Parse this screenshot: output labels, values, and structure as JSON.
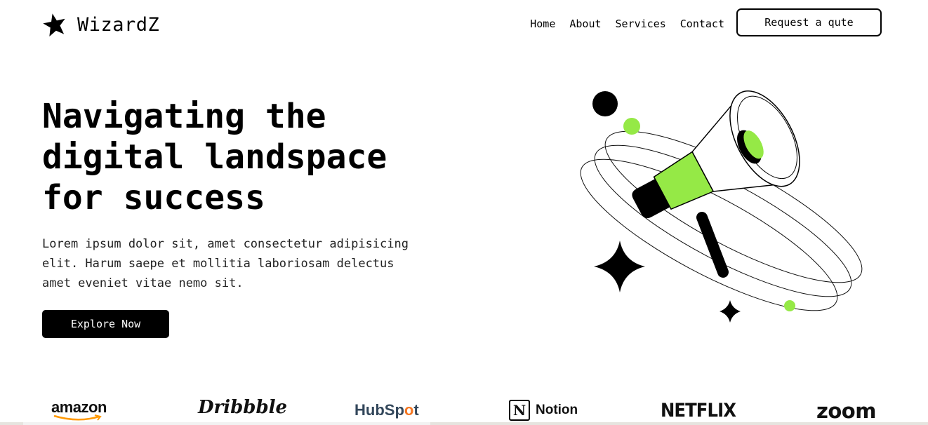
{
  "brand": {
    "name": "WizardZ",
    "logo_icon": "star-icon"
  },
  "nav": {
    "items": [
      "Home",
      "About",
      "Services",
      "Contact"
    ],
    "cta_label": "Request a qute"
  },
  "hero": {
    "title": "Navigating the digital landspace for success",
    "title_lines": [
      "Navigating the",
      "digital landspace",
      "for success"
    ],
    "description_lines": [
      "Lorem ipsum dolor sit, amet consectetur adipisicing",
      "elit. Harum saepe et mollitia laboriosam delectus",
      "amet eveniet vitae nemo sit."
    ],
    "button_label": "Explore Now",
    "illustration_icon": "megaphone-icon"
  },
  "partners": {
    "amazon": "amazon",
    "dribbble": "Dribbble",
    "hubspot": {
      "part1": "HubSp",
      "part2": "o",
      "part3": "t"
    },
    "notion": {
      "glyph": "N",
      "label": "Notion"
    },
    "netflix": "NETFLIX",
    "zoom": "zoom"
  },
  "colors": {
    "accent": "#95e946",
    "primary": "#000000",
    "background": "#ffffff",
    "hubspot_orange": "#f57722"
  }
}
